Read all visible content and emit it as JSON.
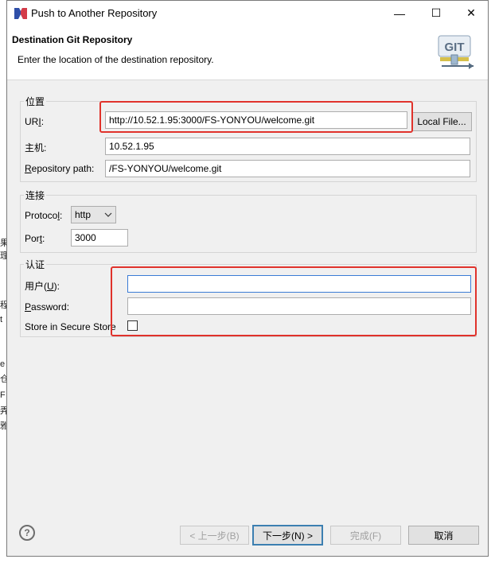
{
  "window": {
    "title": "Push to Another Repository",
    "min_glyph": "—",
    "max_glyph": "☐",
    "close_glyph": "✕"
  },
  "header": {
    "title": "Destination Git Repository",
    "description": "Enter the location of the destination repository.",
    "git_icon_text": "GIT"
  },
  "location": {
    "legend": "位置",
    "uri_label": "UR",
    "uri_label_u": "I",
    "uri_label_colon": ":",
    "uri_value": "http://10.52.1.95:3000/FS-YONYOU/welcome.git",
    "local_file_label": "Local File...",
    "host_label": "主机:",
    "host_value": "10.52.1.95",
    "repo_path_label_u": "R",
    "repo_path_label": "epository path:",
    "repo_path_value": "/FS-YONYOU/welcome.git"
  },
  "connection": {
    "legend": "连接",
    "protocol_label": "Protoco",
    "protocol_label_u": "l",
    "protocol_label_colon": ":",
    "protocol_value": "http",
    "port_label": "Por",
    "port_label_u": "t",
    "port_label_colon": ":",
    "port_value": "3000"
  },
  "auth": {
    "legend": "认证",
    "user_label_pre": "用户(",
    "user_label_u": "U",
    "user_label_post": "):",
    "user_value": "",
    "password_label_u": "P",
    "password_label": "assword:",
    "password_value": "",
    "secure_store_label": "Store in Secure Store",
    "secure_store_checked": false
  },
  "footer": {
    "help_glyph": "?",
    "back_label": "< 上一步(B)",
    "next_label": "下一步(N) >",
    "finish_label": "完成(F)",
    "cancel_label": "取消"
  },
  "background_fragments": [
    "果",
    "理",
    "程",
    "t",
    "e",
    "仓",
    "F",
    "弄",
    "雅"
  ],
  "colors": {
    "highlight_red": "#e0322b",
    "focus_blue": "#3a7bd5",
    "default_button_border": "#3c7fb1"
  }
}
